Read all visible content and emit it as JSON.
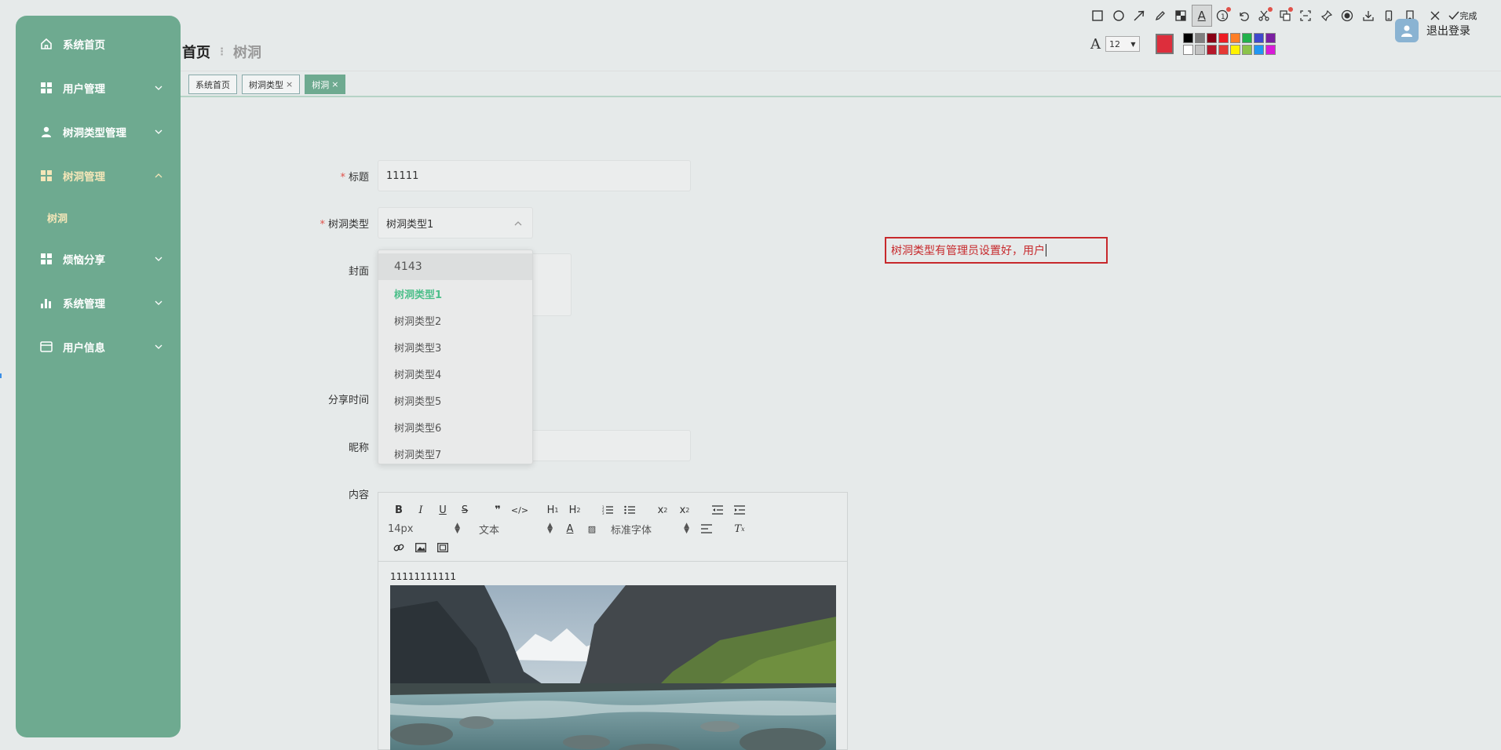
{
  "sidebar": {
    "items": [
      {
        "label": "系统首页",
        "icon": "home-icon"
      },
      {
        "label": "用户管理",
        "icon": "grid-icon"
      },
      {
        "label": "树洞类型管理",
        "icon": "user-icon"
      },
      {
        "label": "树洞管理",
        "icon": "grid-icon",
        "active": true,
        "children": [
          {
            "label": "树洞"
          }
        ]
      },
      {
        "label": "烦恼分享",
        "icon": "grid-icon"
      },
      {
        "label": "系统管理",
        "icon": "bar-chart-icon"
      },
      {
        "label": "用户信息",
        "icon": "card-icon"
      }
    ]
  },
  "header": {
    "home": "首页",
    "current": "树洞",
    "logout": "退出登录"
  },
  "tabs": [
    {
      "label": "系统首页",
      "closable": false
    },
    {
      "label": "树洞类型",
      "closable": true
    },
    {
      "label": "树洞",
      "closable": true,
      "active": true
    }
  ],
  "form": {
    "title_label": "标题",
    "title_value": "11111",
    "type_label": "树洞类型",
    "type_value": "树洞类型1",
    "cover_label": "封面",
    "share_time_label": "分享时间",
    "nickname_label": "昵称",
    "content_label": "内容",
    "required_mark": "*"
  },
  "dropdown": {
    "options": [
      "4143",
      "树洞类型1",
      "树洞类型2",
      "树洞类型3",
      "树洞类型4",
      "树洞类型5",
      "树洞类型6",
      "树洞类型7"
    ],
    "hovered_index": 0,
    "selected_index": 1
  },
  "editor": {
    "font_size": "14px",
    "block_type": "文本",
    "font_family": "标准字体",
    "content_text": "11111111111",
    "buttons": [
      "B",
      "I",
      "U",
      "S"
    ]
  },
  "annotation": {
    "text": "树洞类型有管理员设置好，用户"
  },
  "snip_tool": {
    "done_label": "完成",
    "font_size": "12",
    "current_color": "#dd2e3c",
    "palette": [
      "#000000",
      "#7f7f7f",
      "#880015",
      "#ed1c24",
      "#ff7f27",
      "#22b14c",
      "#3f48cc",
      "#7b1fa2",
      "#ffffff",
      "#c3c3c3",
      "#b5182b",
      "#e53935",
      "#fff200",
      "#8bc34a",
      "#2196f3",
      "#d81bd8"
    ]
  },
  "colors": {
    "sidebar_bg": "#6eaa90",
    "accent_green": "#4cbf8a",
    "required_red": "#e0524a",
    "annotation_red": "#c7292c"
  }
}
